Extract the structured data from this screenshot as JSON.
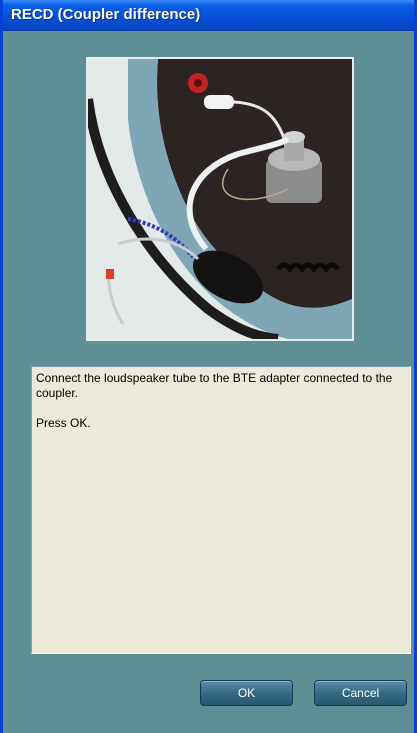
{
  "window": {
    "title": "RECD (Coupler difference)"
  },
  "photo": {
    "description_icon": "coupler-setup-photo"
  },
  "instructions": {
    "line1": "Connect the loudspeaker tube to the BTE adapter connected to the coupler.",
    "line2": "Press OK."
  },
  "buttons": {
    "ok_label": "OK",
    "cancel_label": "Cancel"
  },
  "colors": {
    "titlebar": "#0750d6",
    "dialog_bg": "#5e8f95",
    "text_area_bg": "#ece9d8",
    "button": "#356a85"
  }
}
